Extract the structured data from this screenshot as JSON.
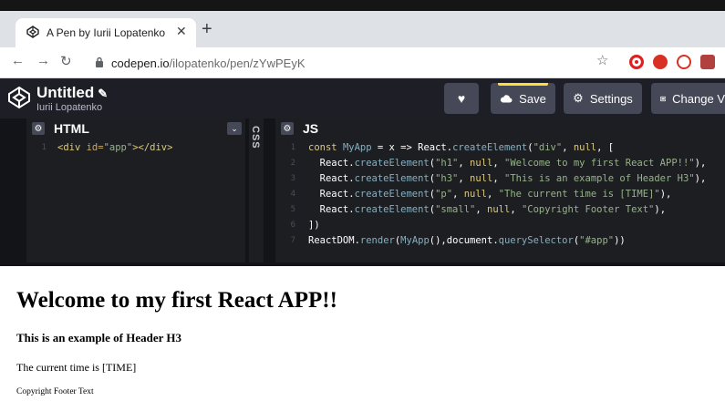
{
  "browser": {
    "tab_title": "A Pen by Iurii Lopatenko",
    "url_host": "codepen.io",
    "url_path": "/ilopatenko/pen/zYwPEyK"
  },
  "codepen": {
    "title": "Untitled",
    "author": "Iurii Lopatenko",
    "buttons": {
      "save": "Save",
      "settings": "Settings",
      "change_view": "Change V"
    }
  },
  "editors": {
    "html_label": "HTML",
    "css_label": "CSS",
    "js_label": "JS",
    "html_code": [
      {
        "num": "1",
        "tag_open": "<div ",
        "attr": "id=",
        "val": "\"app\"",
        "tag_close": "></div>"
      }
    ],
    "js_code": [
      {
        "num": "1",
        "text": "const MyApp = x => React.createElement(\"div\", null, ["
      },
      {
        "num": "2",
        "text": "  React.createElement(\"h1\", null, \"Welcome to my first React APP!!\"),"
      },
      {
        "num": "3",
        "text": "  React.createElement(\"h3\", null, \"This is an example of Header H3\"),"
      },
      {
        "num": "4",
        "text": "  React.createElement(\"p\", null, \"The current time is [TIME]\"),"
      },
      {
        "num": "5",
        "text": "  React.createElement(\"small\", null, \"Copyright Footer Text\"),"
      },
      {
        "num": "6",
        "text": "])"
      },
      {
        "num": "7",
        "text": "ReactDOM.render(MyApp(),document.querySelector(\"#app\"))"
      }
    ]
  },
  "output": {
    "h1": "Welcome to my first React APP!!",
    "h3": "This is an example of Header H3",
    "p": "The current time is [TIME]",
    "small": "Copyright Footer Text"
  },
  "colors": {
    "header_bg": "#1e1f26",
    "editor_bg": "#1d1e22",
    "button_bg": "#444857",
    "save_accent": "#ffdd40"
  }
}
